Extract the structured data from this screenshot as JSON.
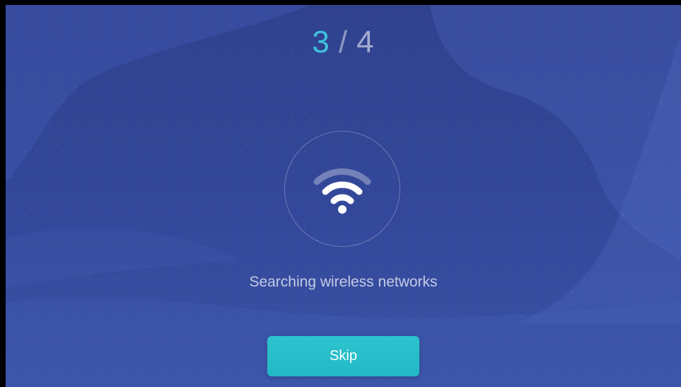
{
  "wizard": {
    "step_current": "3",
    "step_separator": "/",
    "step_total": "4"
  },
  "status": {
    "icon": "wifi-icon",
    "text": "Searching wireless networks"
  },
  "actions": {
    "skip_label": "Skip"
  },
  "colors": {
    "background": "#33489a",
    "accent": "#3ec2dc",
    "button": "#26bcc9"
  }
}
